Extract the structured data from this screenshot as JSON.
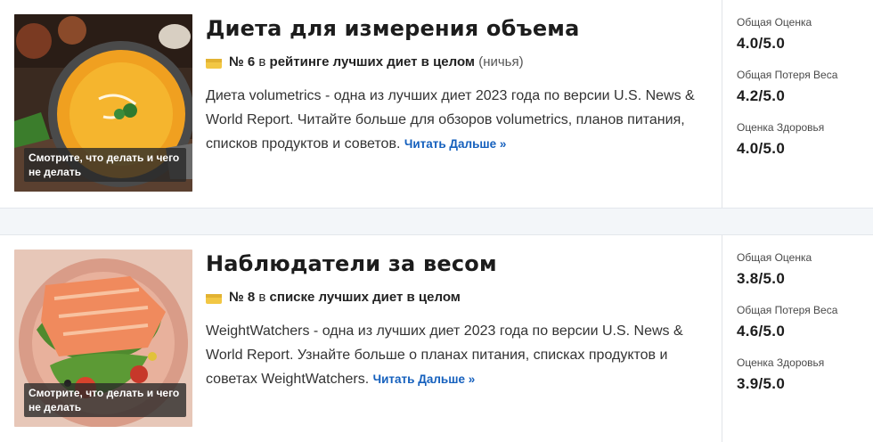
{
  "diets": [
    {
      "title": "Диета для измерения объема",
      "rank_number": "№ 6",
      "rank_pre": "в",
      "rank_bold": "рейтинге лучших диет в целом",
      "rank_note": "(ничья)",
      "description": "Диета volumetrics - одна из лучших диет 2023 года по версии U.S. News & World Report. Читайте больше для обзоров volumetrics, планов питания, списков продуктов и советов.",
      "read_more": "Читать Дальше »",
      "image_caption": "Смотрите, что делать и чего не делать",
      "scores": [
        {
          "label": "Общая Оценка",
          "value": "4.0/5.0"
        },
        {
          "label": "Общая Потеря Веса",
          "value": "4.2/5.0"
        },
        {
          "label": "Оценка Здоровья",
          "value": "4.0/5.0"
        }
      ]
    },
    {
      "title": "Наблюдатели за весом",
      "rank_number": "№ 8",
      "rank_pre": "в",
      "rank_bold": "списке лучших диет в целом",
      "rank_note": "",
      "description": "WeightWatchers - одна из лучших диет 2023 года по версии U.S. News & World Report. Узнайте больше о планах питания, списках продуктов и советах WeightWatchers.",
      "read_more": "Читать Дальше »",
      "image_caption": "Смотрите, что делать и чего не делать",
      "scores": [
        {
          "label": "Общая Оценка",
          "value": "3.8/5.0"
        },
        {
          "label": "Общая Потеря Веса",
          "value": "4.6/5.0"
        },
        {
          "label": "Оценка Здоровья",
          "value": "3.9/5.0"
        }
      ]
    }
  ],
  "colors": {
    "link": "#1560bd",
    "medal": "#f2c744",
    "band": "#f3f6f9"
  }
}
